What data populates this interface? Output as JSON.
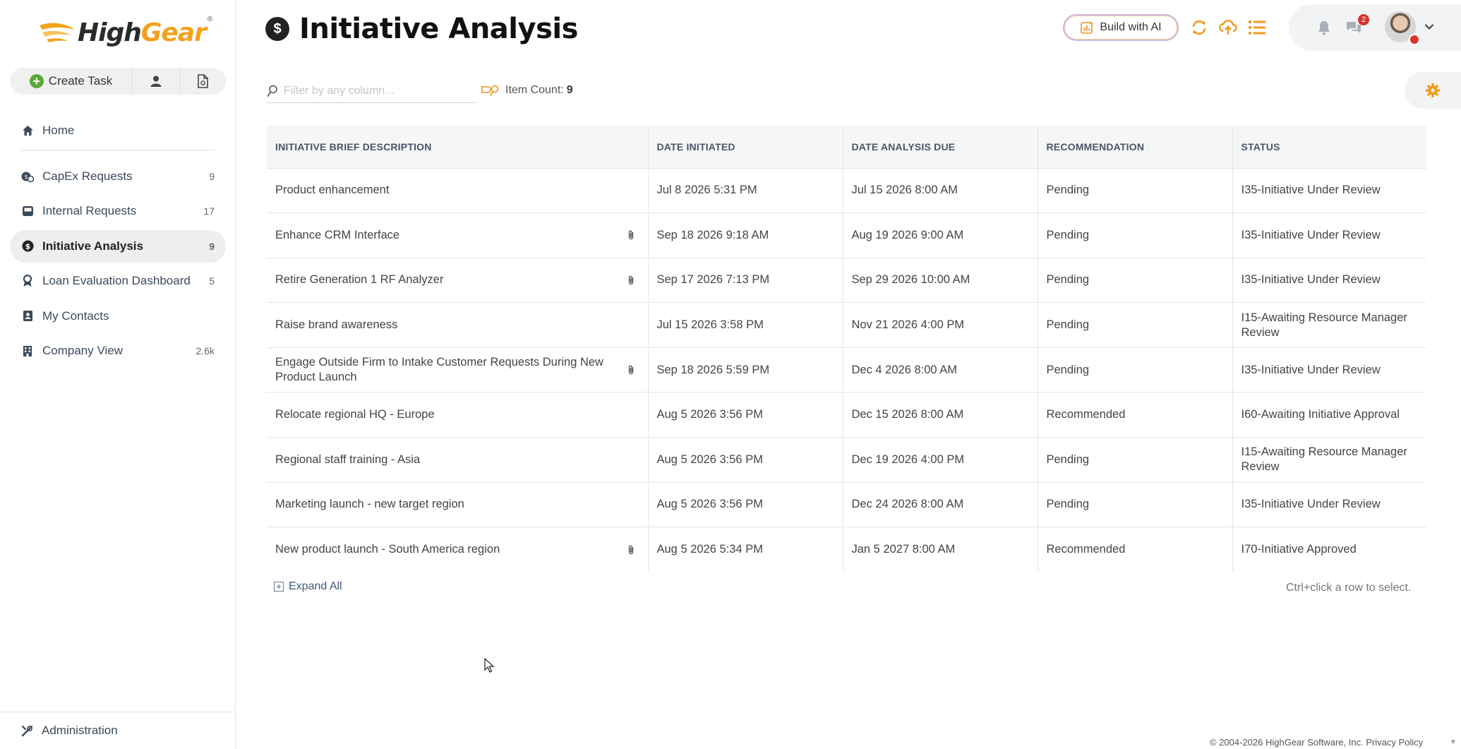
{
  "app": {
    "logo_main": "High",
    "logo_accent": "Gear",
    "logo_reg": "®"
  },
  "sidebar": {
    "create_task_label": "Create Task",
    "items": [
      {
        "label": "Home",
        "count": "",
        "icon": "home-icon"
      },
      {
        "label": "CapEx Requests",
        "count": "9",
        "icon": "capex-icon"
      },
      {
        "label": "Internal Requests",
        "count": "17",
        "icon": "inbox-icon"
      },
      {
        "label": "Initiative Analysis",
        "count": "9",
        "icon": "dollar-icon"
      },
      {
        "label": "Loan Evaluation Dashboard",
        "count": "5",
        "icon": "ribbon-icon"
      },
      {
        "label": "My Contacts",
        "count": "",
        "icon": "contacts-icon"
      },
      {
        "label": "Company View",
        "count": "2.6k",
        "icon": "building-icon"
      }
    ],
    "admin_label": "Administration"
  },
  "header": {
    "title": "Initiative Analysis",
    "title_icon": "$",
    "ai_button_label": "Build with AI",
    "notification_count": "2"
  },
  "toolbar": {
    "filter_placeholder": "Filter by any column...",
    "item_count_label": "Item Count:",
    "item_count_value": "9"
  },
  "table": {
    "columns": [
      "INITIATIVE BRIEF DESCRIPTION",
      "DATE INITIATED",
      "DATE ANALYSIS DUE",
      "RECOMMENDATION",
      "STATUS"
    ],
    "rows": [
      {
        "desc": "Product enhancement",
        "attach": false,
        "initiated": "Jul 8 2026  5:31 PM",
        "due": "Jul 15 2026  8:00 AM",
        "rec": "Pending",
        "status": "I35-Initiative Under Review"
      },
      {
        "desc": "Enhance CRM Interface",
        "attach": true,
        "initiated": "Sep 18 2026  9:18 AM",
        "due": "Aug 19 2026  9:00 AM",
        "rec": "Pending",
        "status": "I35-Initiative Under Review"
      },
      {
        "desc": "Retire Generation 1 RF Analyzer",
        "attach": true,
        "initiated": "Sep 17 2026  7:13 PM",
        "due": "Sep 29 2026  10:00 AM",
        "rec": "Pending",
        "status": "I35-Initiative Under Review"
      },
      {
        "desc": "Raise brand awareness",
        "attach": false,
        "initiated": "Jul 15 2026  3:58 PM",
        "due": "Nov 21 2026  4:00 PM",
        "rec": "Pending",
        "status": "I15-Awaiting Resource Manager Review"
      },
      {
        "desc": "Engage Outside Firm to Intake Customer Requests During New Product Launch",
        "attach": true,
        "initiated": "Sep 18 2026  5:59 PM",
        "due": "Dec 4 2026  8:00 AM",
        "rec": "Pending",
        "status": "I35-Initiative Under Review"
      },
      {
        "desc": "Relocate regional HQ - Europe",
        "attach": false,
        "initiated": "Aug 5 2026  3:56 PM",
        "due": "Dec 15 2026  8:00 AM",
        "rec": "Recommended",
        "status": "I60-Awaiting Initiative Approval"
      },
      {
        "desc": "Regional staff training - Asia",
        "attach": false,
        "initiated": "Aug 5 2026  3:56 PM",
        "due": "Dec 19 2026  4:00 PM",
        "rec": "Pending",
        "status": "I15-Awaiting Resource Manager Review"
      },
      {
        "desc": "Marketing launch - new target region",
        "attach": false,
        "initiated": "Aug 5 2026  3:56 PM",
        "due": "Dec 24 2026  8:00 AM",
        "rec": "Pending",
        "status": "I35-Initiative Under Review"
      },
      {
        "desc": "New product launch - South America region",
        "attach": true,
        "initiated": "Aug 5 2026  5:34 PM",
        "due": "Jan 5 2027  8:00 AM",
        "rec": "Recommended",
        "status": "I70-Initiative Approved"
      }
    ]
  },
  "grid_footer": {
    "expand_label": "Expand All",
    "hint": "Ctrl+click a row to select."
  },
  "footer": {
    "copyright": "© 2004-2026 HighGear Software, Inc. Privacy Policy"
  },
  "colors": {
    "accent_orange": "#f2a21d",
    "create_green": "#5aa83a",
    "badge_red": "#d9332b",
    "link_blue": "#3d5a80"
  }
}
